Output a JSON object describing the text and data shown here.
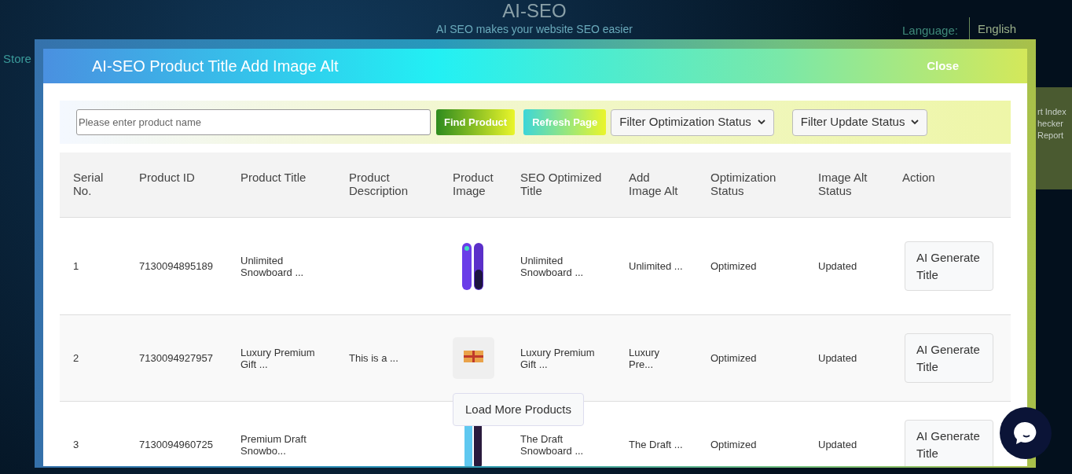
{
  "background": {
    "title": "AI-SEO",
    "subtitle": "AI SEO makes your website SEO easier",
    "language_label": "Language:",
    "language_value": "English",
    "left_text": "Store",
    "right_lines": [
      "rt Index",
      "hecker",
      "Report"
    ]
  },
  "modal": {
    "title": "AI-SEO Product Title Add Image Alt",
    "close": "Close"
  },
  "toolbar": {
    "search_placeholder": "Please enter product name",
    "find_button": "Find Product",
    "refresh_button": "Refresh Page",
    "filters": [
      "Filter Optimization Status",
      "Filter Update Status"
    ]
  },
  "table": {
    "columns": [
      "Serial No.",
      "Product ID",
      "Product Title",
      "Product Description",
      "Product Image",
      "SEO Optimized Title",
      "Add Image Alt",
      "Optimization Status",
      "Image Alt Status",
      "Action"
    ],
    "rows": [
      {
        "serial": "1",
        "product_id": "7130094895189",
        "title": "Unlimited Snowboard ...",
        "image": {
          "kind": "snowboard-pair"
        },
        "seo_title": "Unlimited Snowboard ...",
        "image_alt": "Unlimited ...",
        "optimization": "Optimized",
        "alt_status": "Updated",
        "action": "AI Generate Title"
      },
      {
        "serial": "2",
        "product_id": "7130094927957",
        "title": "Luxury Premium Gift ...",
        "description": "This is a ...",
        "image": {
          "kind": "gift"
        },
        "seo_title": "Luxury Premium Gift ...",
        "image_alt": "Luxury Pre...",
        "optimization": "Optimized",
        "alt_status": "Updated",
        "action": "AI Generate Title"
      },
      {
        "serial": "3",
        "product_id": "7130094960725",
        "title": "Premium Draft Snowbo...",
        "image": {
          "kind": "snowboard"
        },
        "seo_title": "The Draft Snowboard ...",
        "image_alt": "The Draft ...",
        "optimization": "Optimized",
        "alt_status": "Updated",
        "action": "AI Generate Title"
      }
    ]
  },
  "load_more": "Load More Products"
}
